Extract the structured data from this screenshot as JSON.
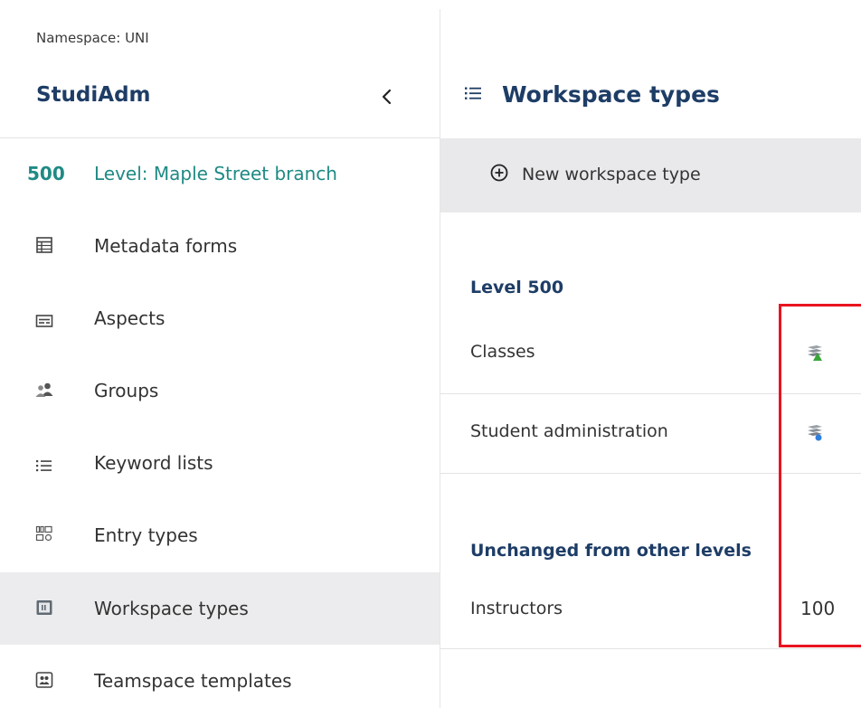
{
  "sidebar": {
    "namespace": "Namespace: UNI",
    "app_title": "StudiAdm",
    "collapse_icon": "chevron-left-icon",
    "level": {
      "number": "500",
      "label": "Level: Maple Street branch",
      "color": "#1f8a84"
    },
    "items": [
      {
        "label": "Metadata forms",
        "icon": "form-table-icon"
      },
      {
        "label": "Aspects",
        "icon": "aspects-icon"
      },
      {
        "label": "Groups",
        "icon": "groups-icon"
      },
      {
        "label": "Keyword lists",
        "icon": "keyword-list-icon"
      },
      {
        "label": "Entry types",
        "icon": "entry-types-icon"
      },
      {
        "label": "Workspace types",
        "icon": "workspace-types-icon",
        "active": true
      },
      {
        "label": "Teamspace templates",
        "icon": "teamspace-templates-icon"
      }
    ]
  },
  "main": {
    "title": "Workspace types",
    "title_icon": "list-icon",
    "toolbar": {
      "new_label": "New workspace type",
      "new_icon": "plus-circle-icon"
    },
    "sections": [
      {
        "title": "Level 500",
        "rows": [
          {
            "label": "Classes",
            "icon": "workspace-type-green-icon"
          },
          {
            "label": "Student administration",
            "icon": "workspace-type-blue-icon"
          }
        ]
      },
      {
        "title": "Unchanged from other levels",
        "rows": [
          {
            "label": "Instructors",
            "value": "100"
          }
        ]
      }
    ]
  },
  "colors": {
    "title": "#1e3d66",
    "accent_teal": "#1f8a84",
    "active_bg": "#ececee",
    "toolbar_bg": "#e9e9eb",
    "highlight": "#e8141f"
  }
}
